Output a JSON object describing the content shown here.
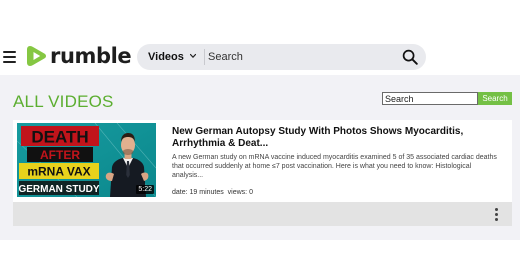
{
  "header": {
    "brand": "rumble",
    "search": {
      "category_label": "Videos",
      "placeholder": "Search"
    }
  },
  "main": {
    "section_title": "ALL VIDEOS",
    "filter": {
      "placeholder": "Search",
      "button_label": "Search"
    },
    "videos": [
      {
        "title": "New German Autopsy Study With Photos Shows Myocarditis, Arrhythmia & Deat...",
        "description": "A new German study on mRNA vaccine induced myocarditis examined 5 of 35 associated cardiac deaths that occurred suddenly at home ≤7 post vaccination. Here is what you need to know: Histological analysis...",
        "date_label": "date:",
        "date_value": "19 minutes",
        "views_label": "views:",
        "views_value": "0",
        "duration": "5:22",
        "thumbnail": {
          "line1": "DEATH",
          "line2": "AFTER",
          "line3": "mRNA VAX",
          "line4": "GERMAN STUDY"
        }
      }
    ]
  },
  "colors": {
    "brand_green": "#85c742",
    "section_title": "#5cae30",
    "filter_button": "#74c045",
    "main_background": "#f2f2f6"
  },
  "icons": {
    "menu": "hamburger-menu-icon",
    "brand": "rumble-play-logo-icon",
    "dropdown": "chevron-down-icon",
    "search": "magnifier-search-icon",
    "more": "vertical-dots-more-icon"
  }
}
